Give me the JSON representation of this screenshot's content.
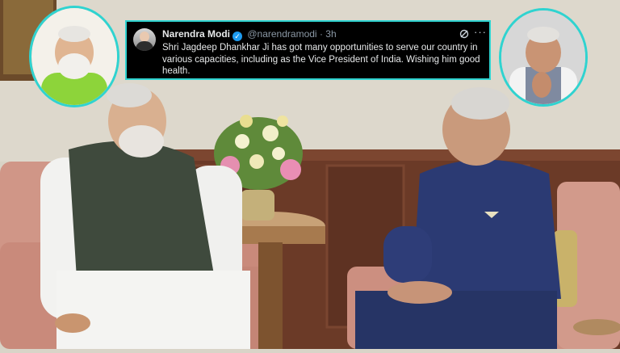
{
  "tweet": {
    "author_name": "Narendra Modi",
    "verified_glyph": "✓",
    "handle": "@narendramodi",
    "separator": "·",
    "time": "3h",
    "text": "Shri Jagdeep Dhankhar Ji has got many opportunities to serve our country in various capacities, including as the Vice President of India. Wishing him good health.",
    "more_glyph": "···",
    "icons": [
      "avatar",
      "verified-badge-icon",
      "grok-icon",
      "more-options-icon"
    ]
  },
  "colors": {
    "frame_accent": "#2fd3d0",
    "tweet_bg": "#000000",
    "verified_blue": "#1d9bf0",
    "suit_blue": "#2b3a73",
    "vest_grey": "#3f4a3d",
    "sofa_pink": "#d49a8a",
    "wall_cream": "#d9d4c8",
    "wood_panel": "#6a3a28"
  }
}
